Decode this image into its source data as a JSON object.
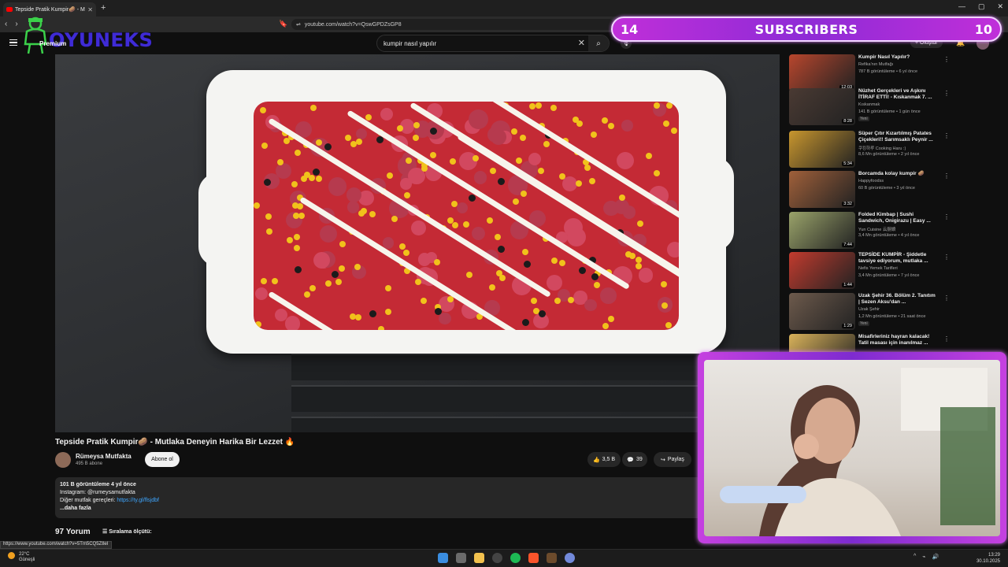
{
  "browser": {
    "tab_title": "Tepside Pratik Kumpir🥔 - Mutla",
    "new_tab": "+",
    "url": "youtube.com/watch?v=QswGPDZsGP8",
    "status_url": "https://www.youtube.com/watch?v=5Tm5CQ5Z8eI",
    "window_controls": [
      "—",
      "▢",
      "✕"
    ]
  },
  "youtube": {
    "premium": "Premium",
    "search_query": "kumpir nasıl yapılır",
    "create_label": "+ Oluştur"
  },
  "overlay": {
    "logo_text": "OYUNEKS",
    "sub_current": "14",
    "sub_label": "SUBSCRIBERS",
    "sub_goal": "10"
  },
  "video": {
    "title": "Tepside Pratik Kumpir🥔 - Mutlaka Deneyin Harika Bir Lezzet 🔥",
    "channel": "Rümeysa Mutfakta",
    "channel_subs": "495 B abone",
    "subscribe_label": "Abone ol",
    "likes": "3,5 B",
    "comments_count": "39",
    "share_label": "Paylaş",
    "desc_line1": "101 B görüntüleme  4 yıl önce",
    "desc_line2": "Instagram: @rumeysamutfakta",
    "desc_line3_prefix": "Diğer mutfak gereçleri: ",
    "desc_link": "https://ty.gl/flsjdbf",
    "desc_more": "...daha fazla",
    "comments_title": "97 Yorum",
    "sort_label": "Sıralama ölçütü:"
  },
  "sidebar": {
    "items": [
      {
        "title": "Kumpir Nasıl Yapılır?",
        "channel": "Refika'nın Mutfağı",
        "meta": "787 B görüntüleme • 6 yıl önce",
        "duration": "12:03",
        "badge": "",
        "thumb_color": "#b8462d"
      },
      {
        "title": "Nüzhet Gerçekleri ve Aşkını İTİRAF ETTİ! - Kıskanmak 7. ...",
        "channel": "Kıskanmak",
        "meta": "141 B görüntüleme • 1 gün önce",
        "duration": "8:28",
        "badge": "Yeni",
        "thumb_color": "#4a3a33"
      },
      {
        "title": "Süper Çıtır Kızartılmış Patates Çiçekleri!! Sarımsaklı Peynir ...",
        "channel": "쿠킹하루 Cooking Haru :)",
        "meta": "8,6 Mn görüntüleme • 2 yıl önce",
        "duration": "5:34",
        "badge": "",
        "thumb_color": "#c8962e"
      },
      {
        "title": "Borcamda kolay kumpir 🥔",
        "channel": "Happyfoodss",
        "meta": "60 B görüntüleme • 3 yıl önce",
        "duration": "3:32",
        "badge": "",
        "thumb_color": "#a0603a"
      },
      {
        "title": "Folded Kimbap | Sushi Sandwich, Onigirazu | Easy ...",
        "channel": "Yun Cuisine 云厨娘",
        "meta": "3,4 Mn görüntüleme • 4 yıl önce",
        "duration": "7:44",
        "badge": "",
        "thumb_color": "#9aa36a"
      },
      {
        "title": "TEPSİDE KUMPİR - Şiddetle tavsiye ediyorum, mutlaka ...",
        "channel": "Nefis Yemek Tarifleri",
        "meta": "3,4 Mn görüntüleme • 7 yıl önce",
        "duration": "1:44",
        "badge": "",
        "thumb_color": "#c23b2e"
      },
      {
        "title": "Uzak Şehir 36. Bölüm 2. Tanıtım | Sezen Aksu'dan ...",
        "channel": "Uzak Şehir",
        "meta": "1,2 Mn görüntüleme • 21 saat önce",
        "duration": "1:29",
        "badge": "Yeni",
        "thumb_color": "#6d5a4c"
      },
      {
        "title": "Misafirleriniz hayran kalacak! Tatil masası için inanılmaz ...",
        "channel": "",
        "meta": "",
        "duration": "",
        "badge": "",
        "thumb_color": "#d9b25a"
      }
    ]
  },
  "taskbar": {
    "temp": "22°C",
    "weather": "Güneşli",
    "time": "13:29",
    "date": "30.10.2025"
  },
  "colors": {
    "accent_purple": "#c02fd9",
    "youtube_red": "#ff0000",
    "link_blue": "#3ea6ff"
  }
}
